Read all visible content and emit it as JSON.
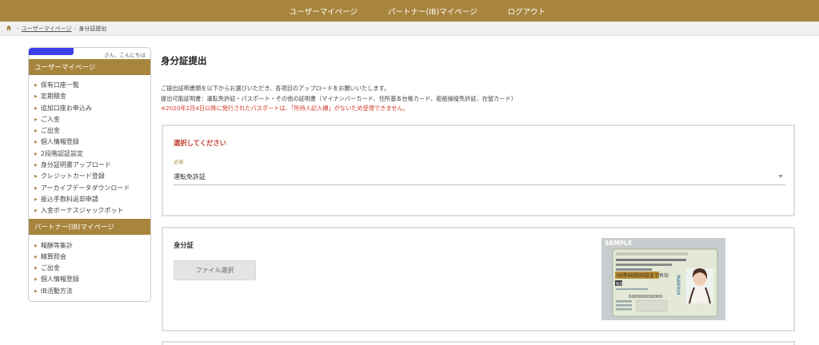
{
  "topnav": {
    "items": [
      "ユーザーマイページ",
      "パートナー(IB)マイページ",
      "ログアウト"
    ]
  },
  "breadcrumb": {
    "home_icon": "home-icon",
    "link": "ユーザーマイページ",
    "separator": "›",
    "current": "身分証提出"
  },
  "sidebar": {
    "greeting": "さん、こんにちは",
    "user_section": {
      "title": "ユーザーマイページ",
      "items": [
        "保有口座一覧",
        "定期積金",
        "追加口座お申込み",
        "ご入金",
        "ご出金",
        "個人情報登録",
        "2段階認証設定",
        "身分証明書アップロード",
        "クレジットカード登録",
        "アーカイブデータダウンロード",
        "振込手数料返却申請",
        "入金ボーナスジャックポット"
      ]
    },
    "partner_section": {
      "title": "パートナー(IB)マイページ",
      "items": [
        "報酬等集計",
        "精算照会",
        "ご出金",
        "個人情報登録",
        "IB活動方法"
      ]
    }
  },
  "main": {
    "title": "身分証提出",
    "desc_line1": "ご提出証明書類を以下からお選びいただき、各項目のアップロードをお願いいたします。",
    "desc_line2": "提出可能証明書：運転免許証・パスポート・その他の証明書（マイナンバーカード、住所基本台帳カード、船舶操縦免許証、在留カード）",
    "warning": "※2020年2月4日以降に発行されたパスポートは、「所持人記入欄」がないため受理できません。",
    "select_card": {
      "title": "選択してください",
      "required_label": "必須",
      "selected_value": "運転免許証"
    },
    "upload_card": {
      "label": "身分証",
      "button_label": "ファイル選択",
      "sample_label": "SAMPLE",
      "license": {
        "date_line": "00年00月00日まで有効",
        "number": "000000000000",
        "category": "免許",
        "vertical_text": "運転免許証"
      }
    }
  },
  "colors": {
    "brand": "#a8853d",
    "warning": "#d23b2b",
    "card_border": "#e0e0e0"
  }
}
